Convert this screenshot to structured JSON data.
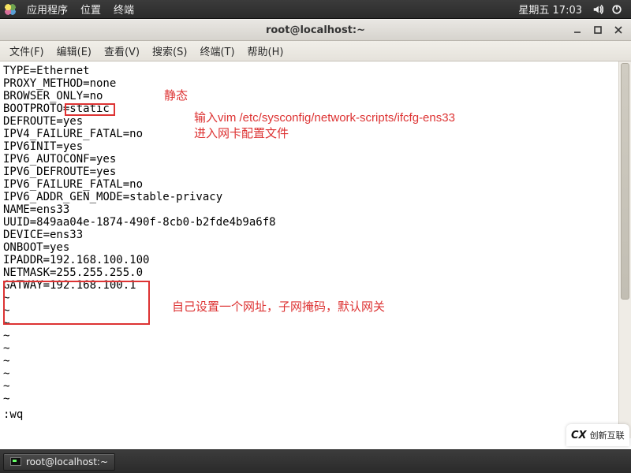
{
  "panel": {
    "menu_apps": "应用程序",
    "menu_places": "位置",
    "menu_terminal": "终端",
    "clock": "星期五 17:03"
  },
  "window": {
    "title": "root@localhost:~"
  },
  "menubar": {
    "file": "文件(F)",
    "edit": "编辑(E)",
    "view": "查看(V)",
    "search": "搜索(S)",
    "terminal": "终端(T)",
    "help": "帮助(H)"
  },
  "term_lines": [
    "TYPE=Ethernet",
    "PROXY_METHOD=none",
    "BROWSER_ONLY=no",
    "BOOTPROTO=static",
    "DEFROUTE=yes",
    "IPV4_FAILURE_FATAL=no",
    "IPV6INIT=yes",
    "IPV6_AUTOCONF=yes",
    "IPV6_DEFROUTE=yes",
    "IPV6_FAILURE_FATAL=no",
    "IPV6_ADDR_GEN_MODE=stable-privacy",
    "NAME=ens33",
    "UUID=849aa04e-1874-490f-8cb0-b2fde4b9a6f8",
    "DEVICE=ens33",
    "ONBOOT=yes",
    "IPADDR=192.168.100.100",
    "NETMASK=255.255.255.0",
    "GATWAY=192.168.100.1"
  ],
  "term_tildes": [
    "~",
    "~",
    "~",
    "~",
    "~",
    "~",
    "~",
    "~",
    "~"
  ],
  "term_cmd": ":wq",
  "annotations": {
    "static_label": "静态",
    "vim_hint_line1": "输入vim /etc/sysconfig/network-scripts/ifcfg-ens33",
    "vim_hint_line2": "进入网卡配置文件",
    "ip_hint": "自己设置一个网址，子网掩码，默认网关"
  },
  "taskbar": {
    "btn_label": "root@localhost:~"
  },
  "watermark": "创新互联"
}
